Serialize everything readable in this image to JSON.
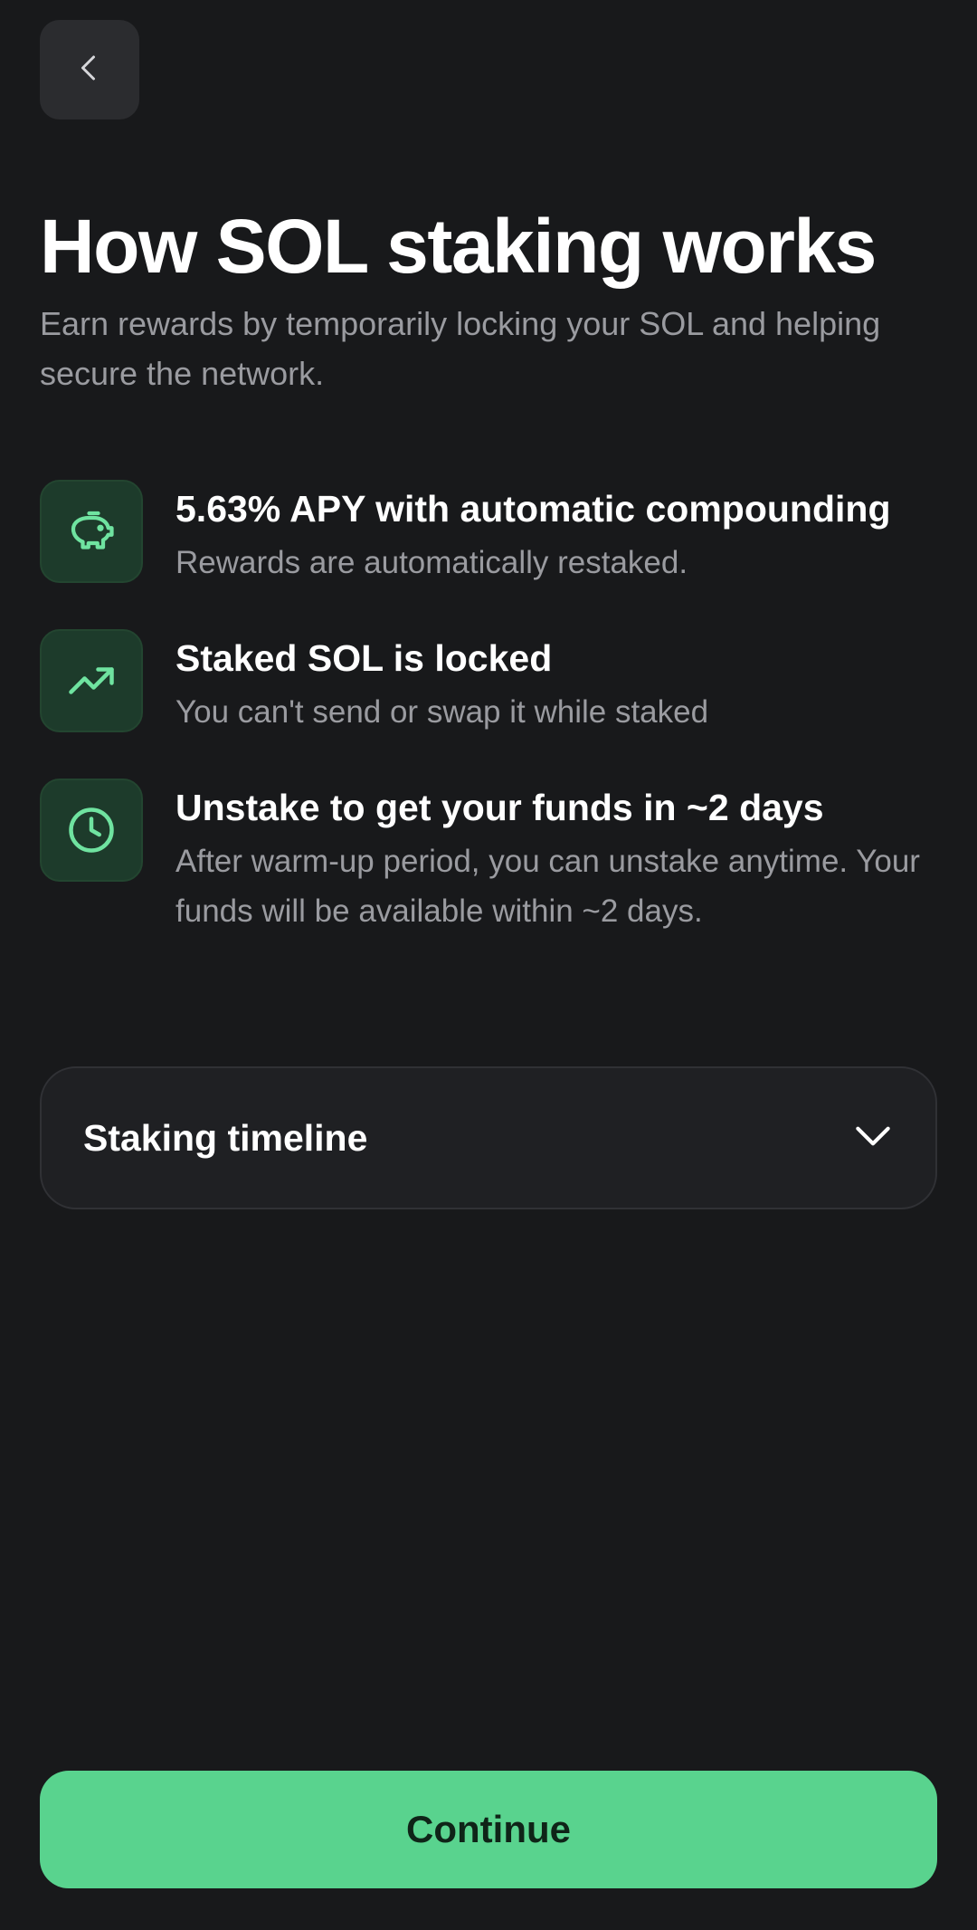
{
  "header": {
    "back_icon": "chevron-left-icon"
  },
  "page": {
    "title": "How SOL staking works",
    "subtitle": "Earn rewards by temporarily locking your SOL and helping secure the network."
  },
  "features": [
    {
      "icon": "piggy-bank-icon",
      "title": "5.63% APY with automatic compounding",
      "description": "Rewards are automatically restaked."
    },
    {
      "icon": "trending-up-icon",
      "title": "Staked SOL is locked",
      "description": "You can't send or swap it while staked"
    },
    {
      "icon": "clock-icon",
      "title": "Unstake to get your funds in ~2 days",
      "description": "After warm-up period, you can unstake anytime. Your funds will be available within ~2 days."
    }
  ],
  "timeline": {
    "label": "Staking timeline",
    "icon": "chevron-down-icon"
  },
  "footer": {
    "continue_label": "Continue"
  },
  "colors": {
    "background": "#18191b",
    "accent": "#59d38e",
    "icon_tile": "#1d3b2b",
    "icon_stroke": "#6fe3a0",
    "muted_text": "#9a9ba0"
  }
}
